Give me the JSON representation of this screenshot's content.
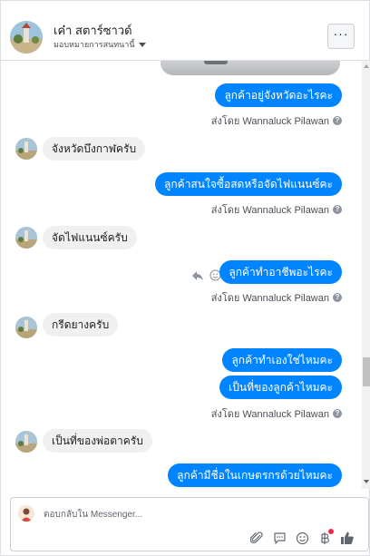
{
  "header": {
    "page_name": "เค๋า สตาร์ซาวด์",
    "assign_label": "มอบหมายการสนทนานี้",
    "more_label": "···"
  },
  "messages": [
    {
      "dir": "out",
      "text": "ลูกค้าอยู่จังหวัดอะไรคะ"
    },
    {
      "dir": "meta",
      "text": "ส่งโดย Wannaluck Pilawan"
    },
    {
      "dir": "in",
      "text": "จังหวัดบึงกาฬครับ"
    },
    {
      "dir": "out",
      "text": "ลูกค้าสนใจซื้อสดหรือจัดไฟแนนซ์คะ"
    },
    {
      "dir": "meta",
      "text": "ส่งโดย Wannaluck Pilawan"
    },
    {
      "dir": "in",
      "text": "จัดไฟแนนซ์ครับ"
    },
    {
      "dir": "out",
      "text": "ลูกค้าทำอาชีพอะไรคะ"
    },
    {
      "dir": "meta",
      "text": "ส่งโดย Wannaluck Pilawan"
    },
    {
      "dir": "in",
      "text": "กรีดยางครับ"
    },
    {
      "dir": "out",
      "text": "ลูกค้าทำเองใช่ไหมคะ"
    },
    {
      "dir": "out",
      "text": "เป็นที่ของลูกค้าไหมคะ"
    },
    {
      "dir": "meta",
      "text": "ส่งโดย Wannaluck Pilawan"
    },
    {
      "dir": "in",
      "text": "เป็นที่ของพ่อตาครับ"
    },
    {
      "dir": "out",
      "text": "ลูกค้ามีชื่อในเกษตรกรด้วยไหมคะ"
    }
  ],
  "composer": {
    "placeholder": "ตอบกลับใน Messenger..."
  },
  "icons": {
    "attach": "paperclip-icon",
    "quick_reply": "saved-reply-icon",
    "emoji": "emoji-icon",
    "payment": "baht-icon",
    "like": "thumbs-up-icon"
  },
  "colors": {
    "accent": "#0084ff",
    "incoming_bubble": "#f1f0f0",
    "notification": "#f02849"
  }
}
